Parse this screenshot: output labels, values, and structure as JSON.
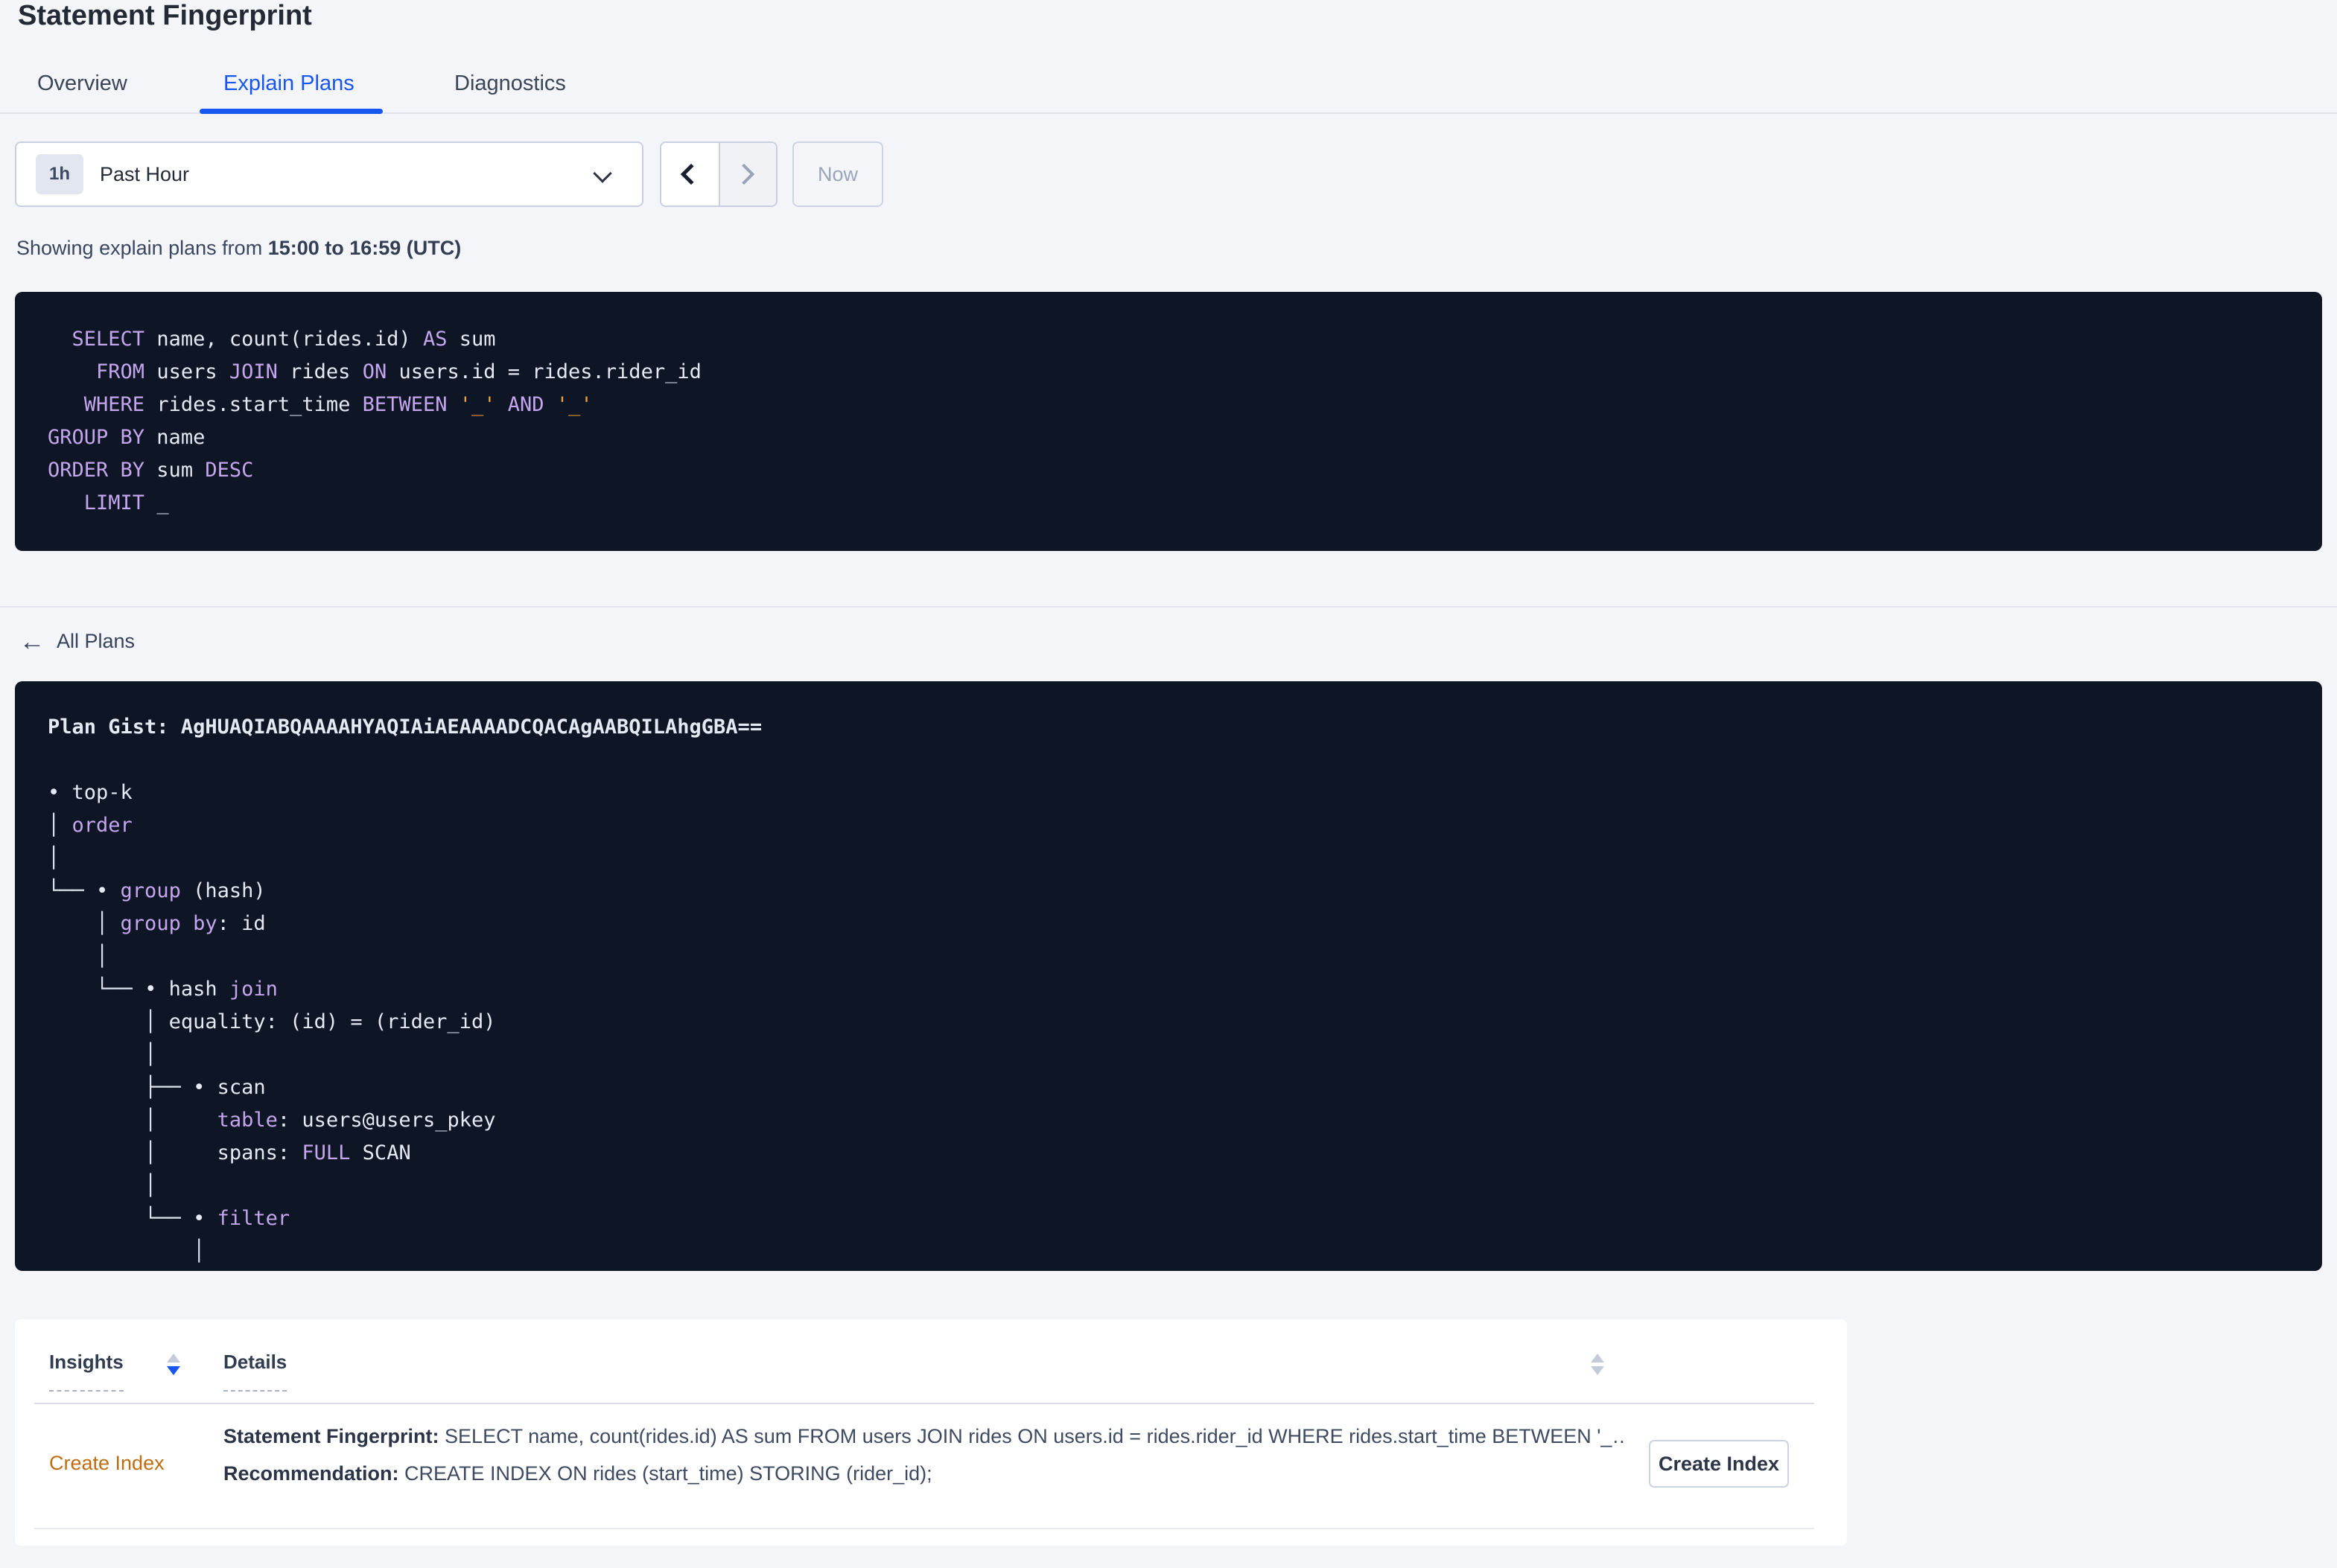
{
  "page": {
    "title": "Statement Fingerprint"
  },
  "tabs": [
    {
      "label": "Overview",
      "active": false
    },
    {
      "label": "Explain Plans",
      "active": true
    },
    {
      "label": "Diagnostics",
      "active": false
    }
  ],
  "time_picker": {
    "badge": "1h",
    "label": "Past Hour",
    "now_label": "Now",
    "prev_enabled": true,
    "next_enabled": false
  },
  "showing": {
    "prefix": "Showing explain plans from ",
    "range": "15:00 to 16:59 (UTC)"
  },
  "sql": {
    "lines": [
      [
        [
          "p",
          "  "
        ],
        [
          "k",
          "SELECT"
        ],
        [
          "p",
          " name, count(rides.id) "
        ],
        [
          "k",
          "AS"
        ],
        [
          "p",
          " sum"
        ]
      ],
      [
        [
          "p",
          "    "
        ],
        [
          "k",
          "FROM"
        ],
        [
          "p",
          " users "
        ],
        [
          "k",
          "JOIN"
        ],
        [
          "p",
          " rides "
        ],
        [
          "k",
          "ON"
        ],
        [
          "p",
          " users.id = rides.rider_id"
        ]
      ],
      [
        [
          "p",
          "   "
        ],
        [
          "k",
          "WHERE"
        ],
        [
          "p",
          " rides.start_time "
        ],
        [
          "k",
          "BETWEEN"
        ],
        [
          "p",
          " "
        ],
        [
          "s",
          "'_'"
        ],
        [
          "p",
          " "
        ],
        [
          "k",
          "AND"
        ],
        [
          "p",
          " "
        ],
        [
          "s",
          "'_'"
        ]
      ],
      [
        [
          "k",
          "GROUP BY"
        ],
        [
          "p",
          " name"
        ]
      ],
      [
        [
          "k",
          "ORDER BY"
        ],
        [
          "p",
          " sum "
        ],
        [
          "k",
          "DESC"
        ]
      ],
      [
        [
          "p",
          "   "
        ],
        [
          "k",
          "LIMIT"
        ],
        [
          "p",
          " _"
        ]
      ]
    ]
  },
  "plan": {
    "back_label": "All Plans",
    "gist_label": "Plan Gist: ",
    "gist_value": "AgHUAQIABQAAAAHYAQIAiAEAAAADCQACAgAABQILAhgGBA==",
    "tree_lines": [
      [
        [
          "p",
          "• top-k"
        ]
      ],
      [
        [
          "t",
          "│ "
        ],
        [
          "k",
          "order"
        ]
      ],
      [
        [
          "t",
          "│"
        ]
      ],
      [
        [
          "t",
          "└── "
        ],
        [
          "p",
          "• "
        ],
        [
          "k",
          "group"
        ],
        [
          "p",
          " (hash)"
        ]
      ],
      [
        [
          "p",
          "    "
        ],
        [
          "t",
          "│ "
        ],
        [
          "k",
          "group by"
        ],
        [
          "p",
          ": id"
        ]
      ],
      [
        [
          "p",
          "    "
        ],
        [
          "t",
          "│"
        ]
      ],
      [
        [
          "p",
          "    "
        ],
        [
          "t",
          "└── "
        ],
        [
          "p",
          "• hash "
        ],
        [
          "k",
          "join"
        ]
      ],
      [
        [
          "p",
          "        "
        ],
        [
          "t",
          "│ "
        ],
        [
          "p",
          "equality: (id) = (rider_id)"
        ]
      ],
      [
        [
          "p",
          "        "
        ],
        [
          "t",
          "│"
        ]
      ],
      [
        [
          "p",
          "        "
        ],
        [
          "t",
          "├── "
        ],
        [
          "p",
          "• scan"
        ]
      ],
      [
        [
          "p",
          "        "
        ],
        [
          "t",
          "│     "
        ],
        [
          "k",
          "table"
        ],
        [
          "p",
          ": users@users_pkey"
        ]
      ],
      [
        [
          "p",
          "        "
        ],
        [
          "t",
          "│     "
        ],
        [
          "p",
          "spans: "
        ],
        [
          "k",
          "FULL"
        ],
        [
          "p",
          " SCAN"
        ]
      ],
      [
        [
          "p",
          "        "
        ],
        [
          "t",
          "│"
        ]
      ],
      [
        [
          "p",
          "        "
        ],
        [
          "t",
          "└── "
        ],
        [
          "p",
          "• "
        ],
        [
          "k",
          "filter"
        ]
      ],
      [
        [
          "p",
          "            "
        ],
        [
          "t",
          "│"
        ]
      ]
    ]
  },
  "insights_table": {
    "columns": [
      {
        "label": "Insights",
        "sort": "desc"
      },
      {
        "label": "Details",
        "sort": "none"
      }
    ],
    "rows": [
      {
        "insight": "Create Index",
        "fingerprint_label": "Statement Fingerprint:",
        "fingerprint_text": "SELECT name, count(rides.id) AS sum FROM users JOIN rides ON users.id = rides.rider_id WHERE rides.start_time BETWEEN '_…",
        "recommendation_label": "Recommendation:",
        "recommendation_text": "CREATE INDEX ON rides (start_time) STORING (rider_id);",
        "action_label": "Create Index"
      }
    ]
  },
  "colors": {
    "accent_blue": "#1757ef",
    "code_background": "#0e1626",
    "code_keyword": "#c5a5ee",
    "code_plain": "#e4eaf4",
    "code_string": "#efa441",
    "insight_link_orange": "#bf6d10",
    "page_background": "#f4f5f9"
  }
}
